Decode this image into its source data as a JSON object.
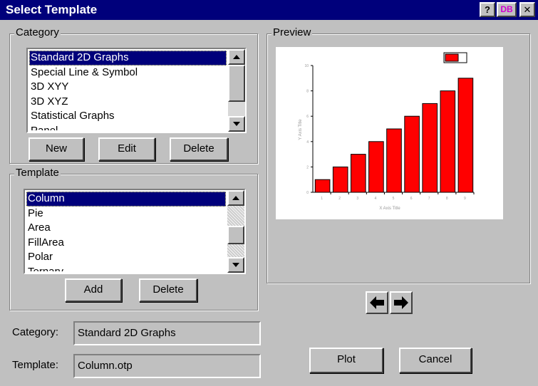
{
  "window": {
    "title": "Select Template",
    "help_label": "?",
    "db_label": "DB",
    "close_label": "✕"
  },
  "category": {
    "group_label": "Category",
    "items": [
      "Standard 2D Graphs",
      "Special Line & Symbol",
      "3D XYY",
      "3D XYZ",
      "Statistical Graphs",
      "Panel"
    ],
    "selected_index": 0,
    "buttons": {
      "new": "New",
      "edit": "Edit",
      "delete": "Delete"
    }
  },
  "template": {
    "group_label": "Template",
    "items": [
      "Column",
      "Pie",
      "Area",
      "FillArea",
      "Polar",
      "Ternary"
    ],
    "selected_index": 0,
    "buttons": {
      "add": "Add",
      "delete": "Delete"
    }
  },
  "fields": {
    "category_label": "Category:",
    "category_value": "Standard 2D Graphs",
    "template_label": "Template:",
    "template_value": "Column.otp"
  },
  "preview": {
    "group_label": "Preview"
  },
  "chart_data": {
    "type": "bar",
    "categories": [
      "1",
      "2",
      "3",
      "4",
      "5",
      "6",
      "7",
      "8",
      "9"
    ],
    "values": [
      1,
      2,
      3,
      4,
      5,
      6,
      7,
      8,
      9
    ],
    "ylim": [
      0,
      10
    ],
    "xlabel": "X Axis Title",
    "ylabel": "Y Axis Title",
    "bar_color": "#ff0000",
    "legend": "top-right"
  },
  "nav": {
    "prev_icon": "arrow-left-icon",
    "next_icon": "arrow-right-icon"
  },
  "actions": {
    "plot": "Plot",
    "cancel": "Cancel"
  }
}
